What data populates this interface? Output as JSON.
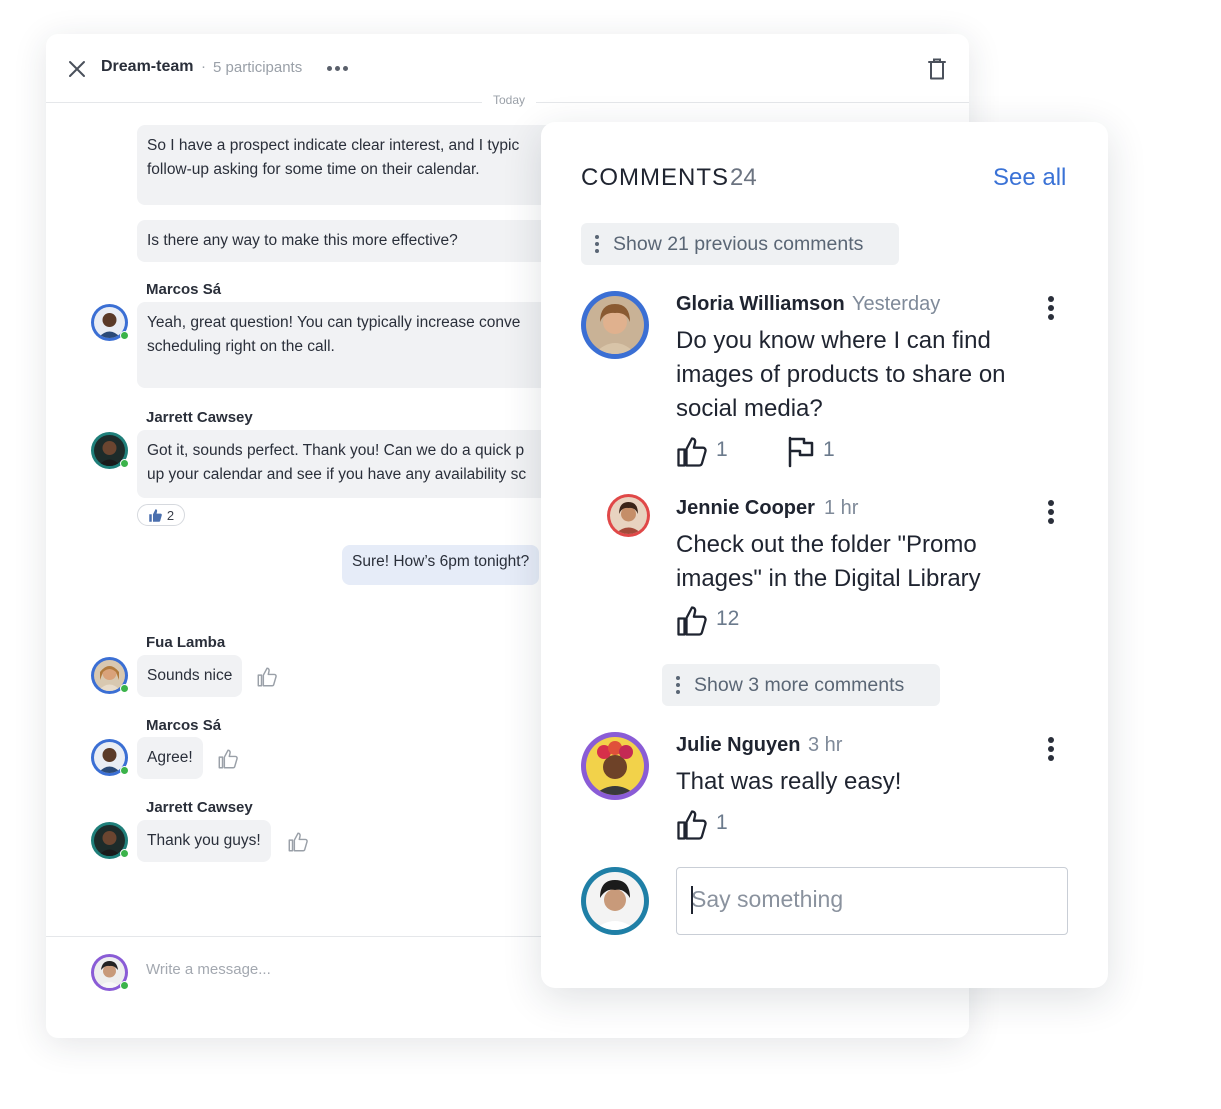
{
  "chat": {
    "title": "Dream-team",
    "separator": "·",
    "participants": "5 participants",
    "day_divider": "Today",
    "messages": [
      {
        "sender": "",
        "lines": [
          "So I have a prospect indicate clear interest, and I typic",
          "follow-up asking for some time on their calendar."
        ]
      },
      {
        "sender": "",
        "lines": [
          "Is there any way to make this more effective?"
        ]
      },
      {
        "sender": "Marcos Sá",
        "lines": [
          "Yeah, great question! You can typically increase conve",
          "scheduling right on the call."
        ]
      },
      {
        "sender": "Jarrett Cawsey",
        "lines": [
          "Got it, sounds perfect. Thank you! Can we do a quick p",
          "up your calendar and see if you have any availability sc"
        ],
        "reaction_count": "2"
      },
      {
        "sender": "me",
        "text": "Sure! How’s 6pm tonight?"
      },
      {
        "sender": "Fua Lamba",
        "text": "Sounds nice"
      },
      {
        "sender": "Marcos Sá",
        "text": "Agree!"
      },
      {
        "sender": "Jarrett Cawsey",
        "text": "Thank you guys!"
      }
    ],
    "composer_placeholder": "Write a message..."
  },
  "comments": {
    "title": "COMMENTS",
    "count": "24",
    "see_all": "See all",
    "show_previous": "Show 21 previous comments",
    "show_more": "Show 3 more comments",
    "items": [
      {
        "name": "Gloria Williamson",
        "time": "Yesterday",
        "text": [
          "Do you know where I can find",
          "images of products to share on",
          "social media?"
        ],
        "likes": "1",
        "flags": "1"
      },
      {
        "name": "Jennie Cooper",
        "time": "1 hr",
        "text": [
          "Check out the folder \"Promo",
          "images\" in the Digital Library"
        ],
        "likes": "12"
      },
      {
        "name": "Julie Nguyen",
        "time": "3 hr",
        "text": [
          "That was really easy!"
        ],
        "likes": "1"
      }
    ],
    "input_placeholder": "Say something"
  },
  "colors": {
    "accent": "#3a72d6",
    "online": "#3bb34a",
    "bubble_in": "#f1f2f4",
    "bubble_out": "#e6ecf8",
    "ring_blue": "#3b6fd4",
    "ring_red": "#e04848",
    "ring_purple": "#8a5cd6",
    "ring_teal": "#1f7fa6"
  }
}
